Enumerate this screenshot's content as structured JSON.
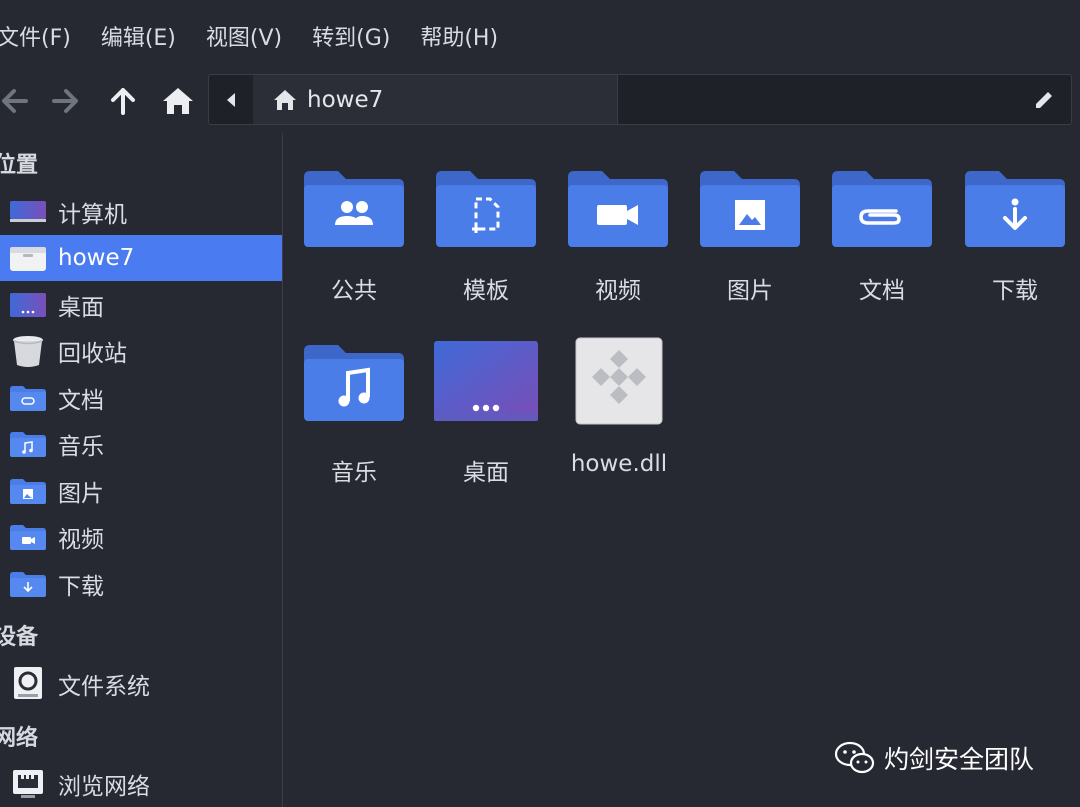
{
  "menu": {
    "file": "文件(F)",
    "edit": "编辑(E)",
    "view": "视图(V)",
    "go": "转到(G)",
    "help": "帮助(H)"
  },
  "toolbar": {
    "back_icon": "arrow-left-icon",
    "forward_icon": "arrow-right-icon",
    "up_icon": "arrow-up-icon",
    "home_icon": "home-icon",
    "path_current": "howe7",
    "edit_icon": "pencil-icon"
  },
  "sidebar": {
    "places_heading": "位置",
    "places": [
      {
        "label": "计算机",
        "icon": "computer-icon"
      },
      {
        "label": "howe7",
        "icon": "home-folder-icon",
        "selected": true
      },
      {
        "label": "桌面",
        "icon": "desktop-icon"
      },
      {
        "label": "回收站",
        "icon": "trash-icon"
      },
      {
        "label": "文档",
        "icon": "documents-folder-icon"
      },
      {
        "label": "音乐",
        "icon": "music-folder-icon"
      },
      {
        "label": "图片",
        "icon": "pictures-folder-icon"
      },
      {
        "label": "视频",
        "icon": "videos-folder-icon"
      },
      {
        "label": "下载",
        "icon": "downloads-folder-icon"
      }
    ],
    "devices_heading": "设备",
    "devices": [
      {
        "label": "文件系统",
        "icon": "drive-icon"
      }
    ],
    "network_heading": "网络",
    "network": [
      {
        "label": "浏览网络",
        "icon": "network-icon"
      }
    ]
  },
  "files": [
    {
      "name": "公共",
      "icon": "public-folder-icon"
    },
    {
      "name": "模板",
      "icon": "templates-folder-icon"
    },
    {
      "name": "视频",
      "icon": "videos-folder-icon"
    },
    {
      "name": "图片",
      "icon": "pictures-folder-icon"
    },
    {
      "name": "文档",
      "icon": "documents-folder-icon"
    },
    {
      "name": "下载",
      "icon": "downloads-folder-icon"
    },
    {
      "name": "音乐",
      "icon": "music-folder-icon"
    },
    {
      "name": "桌面",
      "icon": "desktop-folder-icon"
    },
    {
      "name": "howe.dll",
      "icon": "dll-file-icon"
    }
  ],
  "watermark": "灼剑安全团队",
  "colors": {
    "background": "#262932",
    "selection": "#4b7bf0",
    "folder": "#4a7de8",
    "folder_tab": "#3d67c9"
  }
}
